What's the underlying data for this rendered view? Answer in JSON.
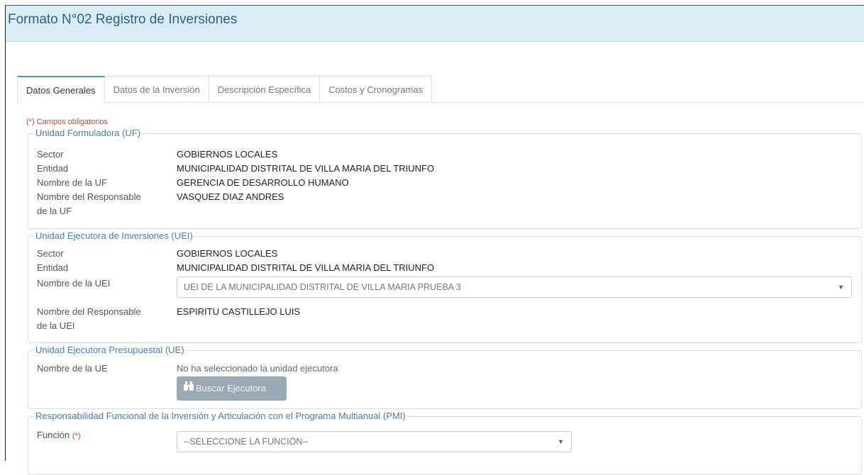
{
  "header": {
    "title": "Formato N°02 Registro de Inversiones"
  },
  "tabs": [
    {
      "label": "Datos Generales",
      "active": true
    },
    {
      "label": "Datos de la Inversión",
      "active": false
    },
    {
      "label": "Descripción Específica",
      "active": false
    },
    {
      "label": "Costos y Cronogramas",
      "active": false
    }
  ],
  "required_note": "(*) Campos obligatorios",
  "uf": {
    "legend": "Unidad Formuladora (UF)",
    "sector_label": "Sector",
    "sector_value": "GOBIERNOS LOCALES",
    "entidad_label": "Entidad",
    "entidad_value": "MUNICIPALIDAD DISTRITAL DE VILLA MARIA DEL TRIUNFO",
    "nombre_label": "Nombre de la UF",
    "nombre_value": "GERENCIA DE DESARROLLO HUMANO",
    "responsable_label_1": "Nombre del Responsable",
    "responsable_label_2": "de la UF",
    "responsable_value": "VASQUEZ DIAZ ANDRES"
  },
  "uei": {
    "legend": "Unidad Ejecutora de Inversiones (UEI)",
    "sector_label": "Sector",
    "sector_value": "GOBIERNOS LOCALES",
    "entidad_label": "Entidad",
    "entidad_value": "MUNICIPALIDAD DISTRITAL DE VILLA MARIA DEL TRIUNFO",
    "nombre_label": "Nombre de la UEI",
    "nombre_selected": "UEI DE LA MUNICIPALIDAD DISTRITAL DE VILLA MARIA PRUEBA 3",
    "responsable_label_1": "Nombre del Responsable",
    "responsable_label_2": "de la UEI",
    "responsable_value": "ESPIRITU CASTILLEJO LUIS"
  },
  "ue": {
    "legend": "Unidad Ejecutora Presupuestal (UE)",
    "nombre_label": "Nombre de la UE",
    "nombre_value": "No ha seleccionado la unidad ejecutora",
    "search_button": "Buscar Ejecutora"
  },
  "pmi": {
    "legend": "Responsabilidad Funcional de la Inversión y Articulación con el Programa Multianual (PMI)",
    "funcion_label": "Función",
    "required_mark": "(*)",
    "funcion_selected": "--SELECCIONE LA FUNCIÓN--"
  },
  "icons": {
    "select_caret": "caret-down-icon",
    "search_button": "binoculars-icon"
  },
  "colors": {
    "header_bg": "#d9ebf5",
    "title": "#2e6189",
    "legend": "#4a7ca8",
    "required": "#c0392b",
    "active_tab_border": "#4a8fc9",
    "button_bg": "#99a9b5"
  }
}
